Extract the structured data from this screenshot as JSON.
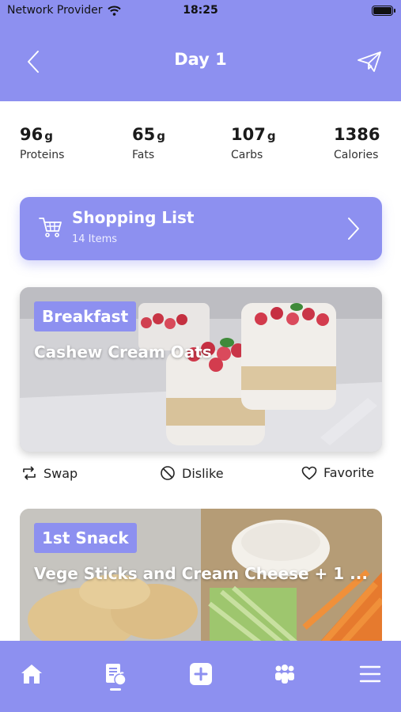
{
  "status_bar": {
    "carrier": "Network Provider",
    "time": "18:25"
  },
  "header": {
    "title": "Day 1"
  },
  "macros": [
    {
      "value": "96",
      "unit": "g",
      "label": "Proteins"
    },
    {
      "value": "65",
      "unit": "g",
      "label": "Fats"
    },
    {
      "value": "107",
      "unit": "g",
      "label": "Carbs"
    },
    {
      "value": "1386",
      "unit": "",
      "label": "Calories"
    }
  ],
  "shopping_list": {
    "title": "Shopping List",
    "subtitle": "14 Items"
  },
  "meals": [
    {
      "tag": "Breakfast",
      "name": "Cashew Cream Oats"
    },
    {
      "tag": "1st Snack",
      "name": "Vege Sticks and Cream Cheese + 1 ..."
    }
  ],
  "meal_actions": {
    "swap": "Swap",
    "dislike": "Dislike",
    "favorite": "Favorite"
  },
  "tabbar": {
    "active": "meal-plan",
    "items": [
      "home-icon",
      "meal-plan-icon",
      "add-icon",
      "community-icon",
      "menu-icon"
    ]
  },
  "colors": {
    "accent": "#8d90f0"
  }
}
